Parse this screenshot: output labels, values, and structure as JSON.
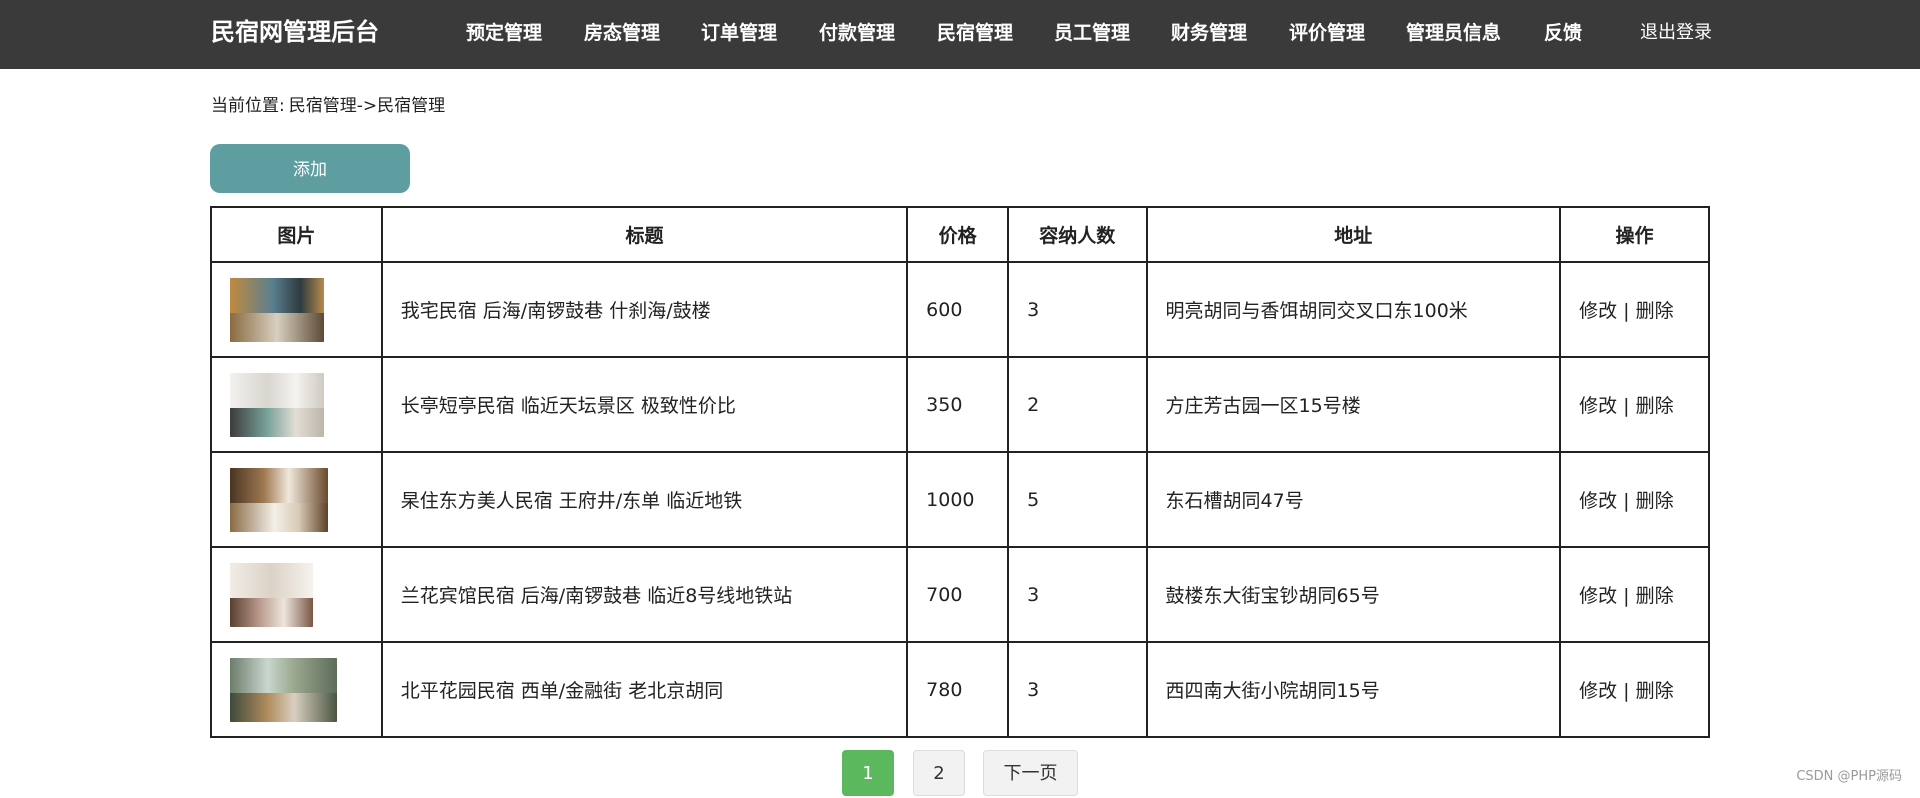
{
  "header": {
    "brand": "民宿网管理后台",
    "nav": [
      {
        "label": "预定管理"
      },
      {
        "label": "房态管理"
      },
      {
        "label": "订单管理"
      },
      {
        "label": "付款管理"
      },
      {
        "label": "民宿管理"
      },
      {
        "label": "员工管理"
      },
      {
        "label": "财务管理"
      },
      {
        "label": "评价管理"
      },
      {
        "label": "管理员信息"
      },
      {
        "label": "反馈"
      }
    ],
    "logout": "退出登录"
  },
  "breadcrumb": {
    "prefix": "当前位置:",
    "trail": "民宿管理->民宿管理"
  },
  "toolbar": {
    "add_label": "添加"
  },
  "table": {
    "headers": [
      "图片",
      "标题",
      "价格",
      "容纳人数",
      "地址",
      "操作"
    ],
    "rows": [
      {
        "image": "room-photo-1",
        "title": "我宅民宿 后海/南锣鼓巷 什刹海/鼓楼",
        "price": "600",
        "capacity": "3",
        "address": "明亮胡同与香饵胡同交叉口东100米",
        "edit": "修改",
        "sep": "|",
        "delete": "删除"
      },
      {
        "image": "room-photo-2",
        "title": "长亭短亭民宿 临近天坛景区 极致性价比",
        "price": "350",
        "capacity": "2",
        "address": "方庄芳古园一区15号楼",
        "edit": "修改",
        "sep": "|",
        "delete": "删除"
      },
      {
        "image": "room-photo-3",
        "title": "杲住东方美人民宿 王府井/东单 临近地铁",
        "price": "1000",
        "capacity": "5",
        "address": "东石槽胡同47号",
        "edit": "修改",
        "sep": "|",
        "delete": "删除"
      },
      {
        "image": "room-photo-4",
        "title": "兰花宾馆民宿 后海/南锣鼓巷 临近8号线地铁站",
        "price": "700",
        "capacity": "3",
        "address": "鼓楼东大街宝钞胡同65号",
        "edit": "修改",
        "sep": "|",
        "delete": "删除"
      },
      {
        "image": "room-photo-5",
        "title": "北平花园民宿 西单/金融街 老北京胡同",
        "price": "780",
        "capacity": "3",
        "address": "西四南大街小院胡同15号",
        "edit": "修改",
        "sep": "|",
        "delete": "删除"
      }
    ]
  },
  "pagination": {
    "pages": [
      "1",
      "2"
    ],
    "current": "1",
    "next_label": "下一页"
  },
  "watermark": "CSDN @PHP源码",
  "colors": {
    "header_bg": "#3a3a3a",
    "add_button": "#5f9ea0",
    "active_page": "#5cb85c"
  }
}
